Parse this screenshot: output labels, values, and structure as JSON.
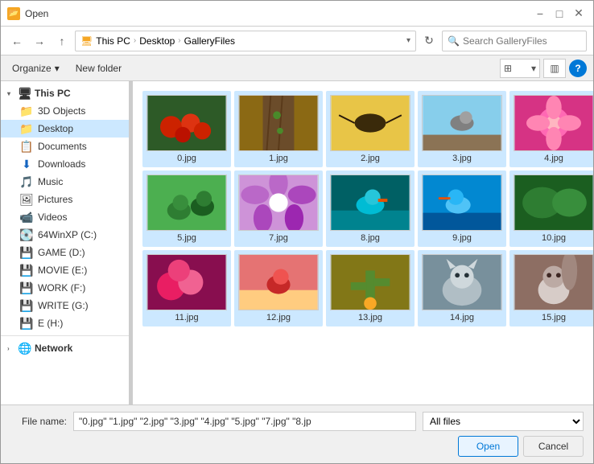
{
  "window": {
    "title": "Open",
    "close_label": "✕",
    "minimize_label": "−",
    "maximize_label": "□"
  },
  "nav": {
    "back_tooltip": "Back",
    "forward_tooltip": "Forward",
    "up_tooltip": "Up",
    "breadcrumb": {
      "parts": [
        "This PC",
        "Desktop",
        "GalleryFiles"
      ],
      "separator": "›"
    },
    "search_placeholder": "Search GalleryFiles",
    "refresh_label": "⟳"
  },
  "toolbar": {
    "organize_label": "Organize",
    "organize_arrow": "▾",
    "new_folder_label": "New folder",
    "view_icon": "▦",
    "view_dropdown": "▾",
    "pane_icon": "▥",
    "help_label": "?"
  },
  "sidebar": {
    "sections": [
      {
        "id": "this-pc",
        "label": "This PC",
        "icon": "🖥",
        "expanded": true,
        "items": [
          {
            "id": "3d-objects",
            "label": "3D Objects",
            "icon": "📁",
            "indent": 1
          },
          {
            "id": "desktop",
            "label": "Desktop",
            "icon": "📁",
            "indent": 1,
            "selected": true
          },
          {
            "id": "documents",
            "label": "Documents",
            "icon": "📋",
            "indent": 1
          },
          {
            "id": "downloads",
            "label": "Downloads",
            "icon": "⬇",
            "indent": 1,
            "color": "blue"
          },
          {
            "id": "music",
            "label": "Music",
            "icon": "🎵",
            "indent": 1
          },
          {
            "id": "pictures",
            "label": "Pictures",
            "icon": "🖼",
            "indent": 1
          },
          {
            "id": "videos",
            "label": "Videos",
            "icon": "📹",
            "indent": 1
          },
          {
            "id": "64winxp-c",
            "label": "64WinXP (C:)",
            "icon": "💽",
            "indent": 1
          },
          {
            "id": "game-d",
            "label": "GAME (D:)",
            "icon": "💾",
            "indent": 1
          },
          {
            "id": "movie-e",
            "label": "MOVIE (E:)",
            "icon": "💾",
            "indent": 1
          },
          {
            "id": "work-f",
            "label": "WORK (F:)",
            "icon": "💾",
            "indent": 1
          },
          {
            "id": "write-g",
            "label": "WRITE (G:)",
            "icon": "💾",
            "indent": 1
          },
          {
            "id": "e-h",
            "label": "E (H:)",
            "icon": "💾",
            "indent": 1
          }
        ]
      },
      {
        "id": "network",
        "label": "Network",
        "icon": "🌐",
        "expanded": false,
        "items": []
      }
    ]
  },
  "files": [
    {
      "id": "file-0",
      "name": "0.jpg",
      "color1": "#e63946",
      "color2": "#2d6a4f"
    },
    {
      "id": "file-1",
      "name": "1.jpg",
      "color1": "#a8dadc",
      "color2": "#6b4226"
    },
    {
      "id": "file-2",
      "name": "2.jpg",
      "color1": "#f4a261",
      "color2": "#264653"
    },
    {
      "id": "file-3",
      "name": "3.jpg",
      "color1": "#2196f3",
      "color2": "#4caf50"
    },
    {
      "id": "file-4",
      "name": "4.jpg",
      "color1": "#e91e63",
      "color2": "#9c27b0"
    },
    {
      "id": "file-5",
      "name": "5.jpg",
      "color1": "#4caf50",
      "color2": "#8bc34a"
    },
    {
      "id": "file-7",
      "name": "7.jpg",
      "color1": "#ce93d8",
      "color2": "#7b1fa2"
    },
    {
      "id": "file-8",
      "name": "8.jpg",
      "color1": "#26c6da",
      "color2": "#006064"
    },
    {
      "id": "file-9",
      "name": "9.jpg",
      "color1": "#0288d1",
      "color2": "#01579b"
    },
    {
      "id": "file-10",
      "name": "10.jpg",
      "color1": "#66bb6a",
      "color2": "#1b5e20"
    },
    {
      "id": "file-11",
      "name": "11.jpg",
      "color1": "#f48fb1",
      "color2": "#880e4f"
    },
    {
      "id": "file-12",
      "name": "12.jpg",
      "color1": "#e57373",
      "color2": "#b71c1c"
    },
    {
      "id": "file-13",
      "name": "13.jpg",
      "color1": "#a5d6a7",
      "color2": "#f9a825"
    },
    {
      "id": "file-14",
      "name": "14.jpg",
      "color1": "#90a4ae",
      "color2": "#546e7a"
    },
    {
      "id": "file-15",
      "name": "15.jpg",
      "color1": "#d7ccc8",
      "color2": "#6d4c41"
    }
  ],
  "bottom": {
    "filename_label": "File name:",
    "filename_value": "\"0.jpg\" \"1.jpg\" \"2.jpg\" \"3.jpg\" \"4.jpg\" \"5.jpg\" \"7.jpg\" \"8.jp",
    "filetype_placeholder": "",
    "open_label": "Open",
    "cancel_label": "Cancel"
  }
}
